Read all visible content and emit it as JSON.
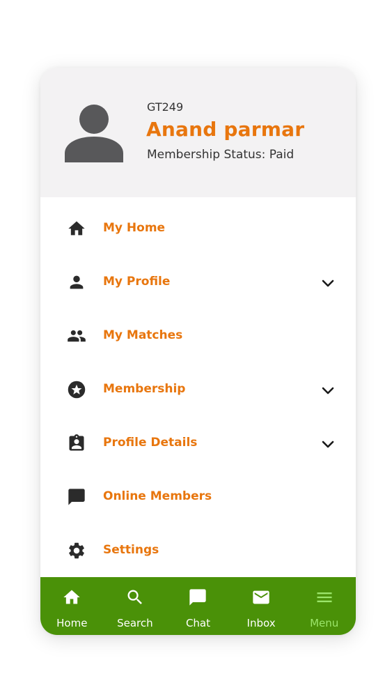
{
  "profile": {
    "id": "GT249",
    "name": "Anand parmar",
    "membership_status": "Membership Status: Paid"
  },
  "menu": {
    "items": [
      {
        "label": "My Home",
        "icon": "home-icon",
        "expandable": false
      },
      {
        "label": "My Profile",
        "icon": "person-icon",
        "expandable": true
      },
      {
        "label": "My Matches",
        "icon": "people-icon",
        "expandable": false
      },
      {
        "label": "Membership",
        "icon": "star-circle-icon",
        "expandable": true
      },
      {
        "label": "Profile Details",
        "icon": "clipboard-user-icon",
        "expandable": true
      },
      {
        "label": "Online Members",
        "icon": "chat-bubble-icon",
        "expandable": false
      },
      {
        "label": "Settings",
        "icon": "gear-icon",
        "expandable": false
      }
    ]
  },
  "bottom_nav": {
    "items": [
      {
        "label": "Home",
        "icon": "home-icon"
      },
      {
        "label": "Search",
        "icon": "search-icon"
      },
      {
        "label": "Chat",
        "icon": "chat-bubble-icon"
      },
      {
        "label": "Inbox",
        "icon": "mail-icon"
      },
      {
        "label": "Menu",
        "icon": "hamburger-icon",
        "active": true
      }
    ]
  },
  "colors": {
    "accent": "#e8760e",
    "nav_background": "#4a9108",
    "nav_active": "#9be56a",
    "header_background": "#f3f2f3",
    "icon": "#2b2b2b"
  }
}
